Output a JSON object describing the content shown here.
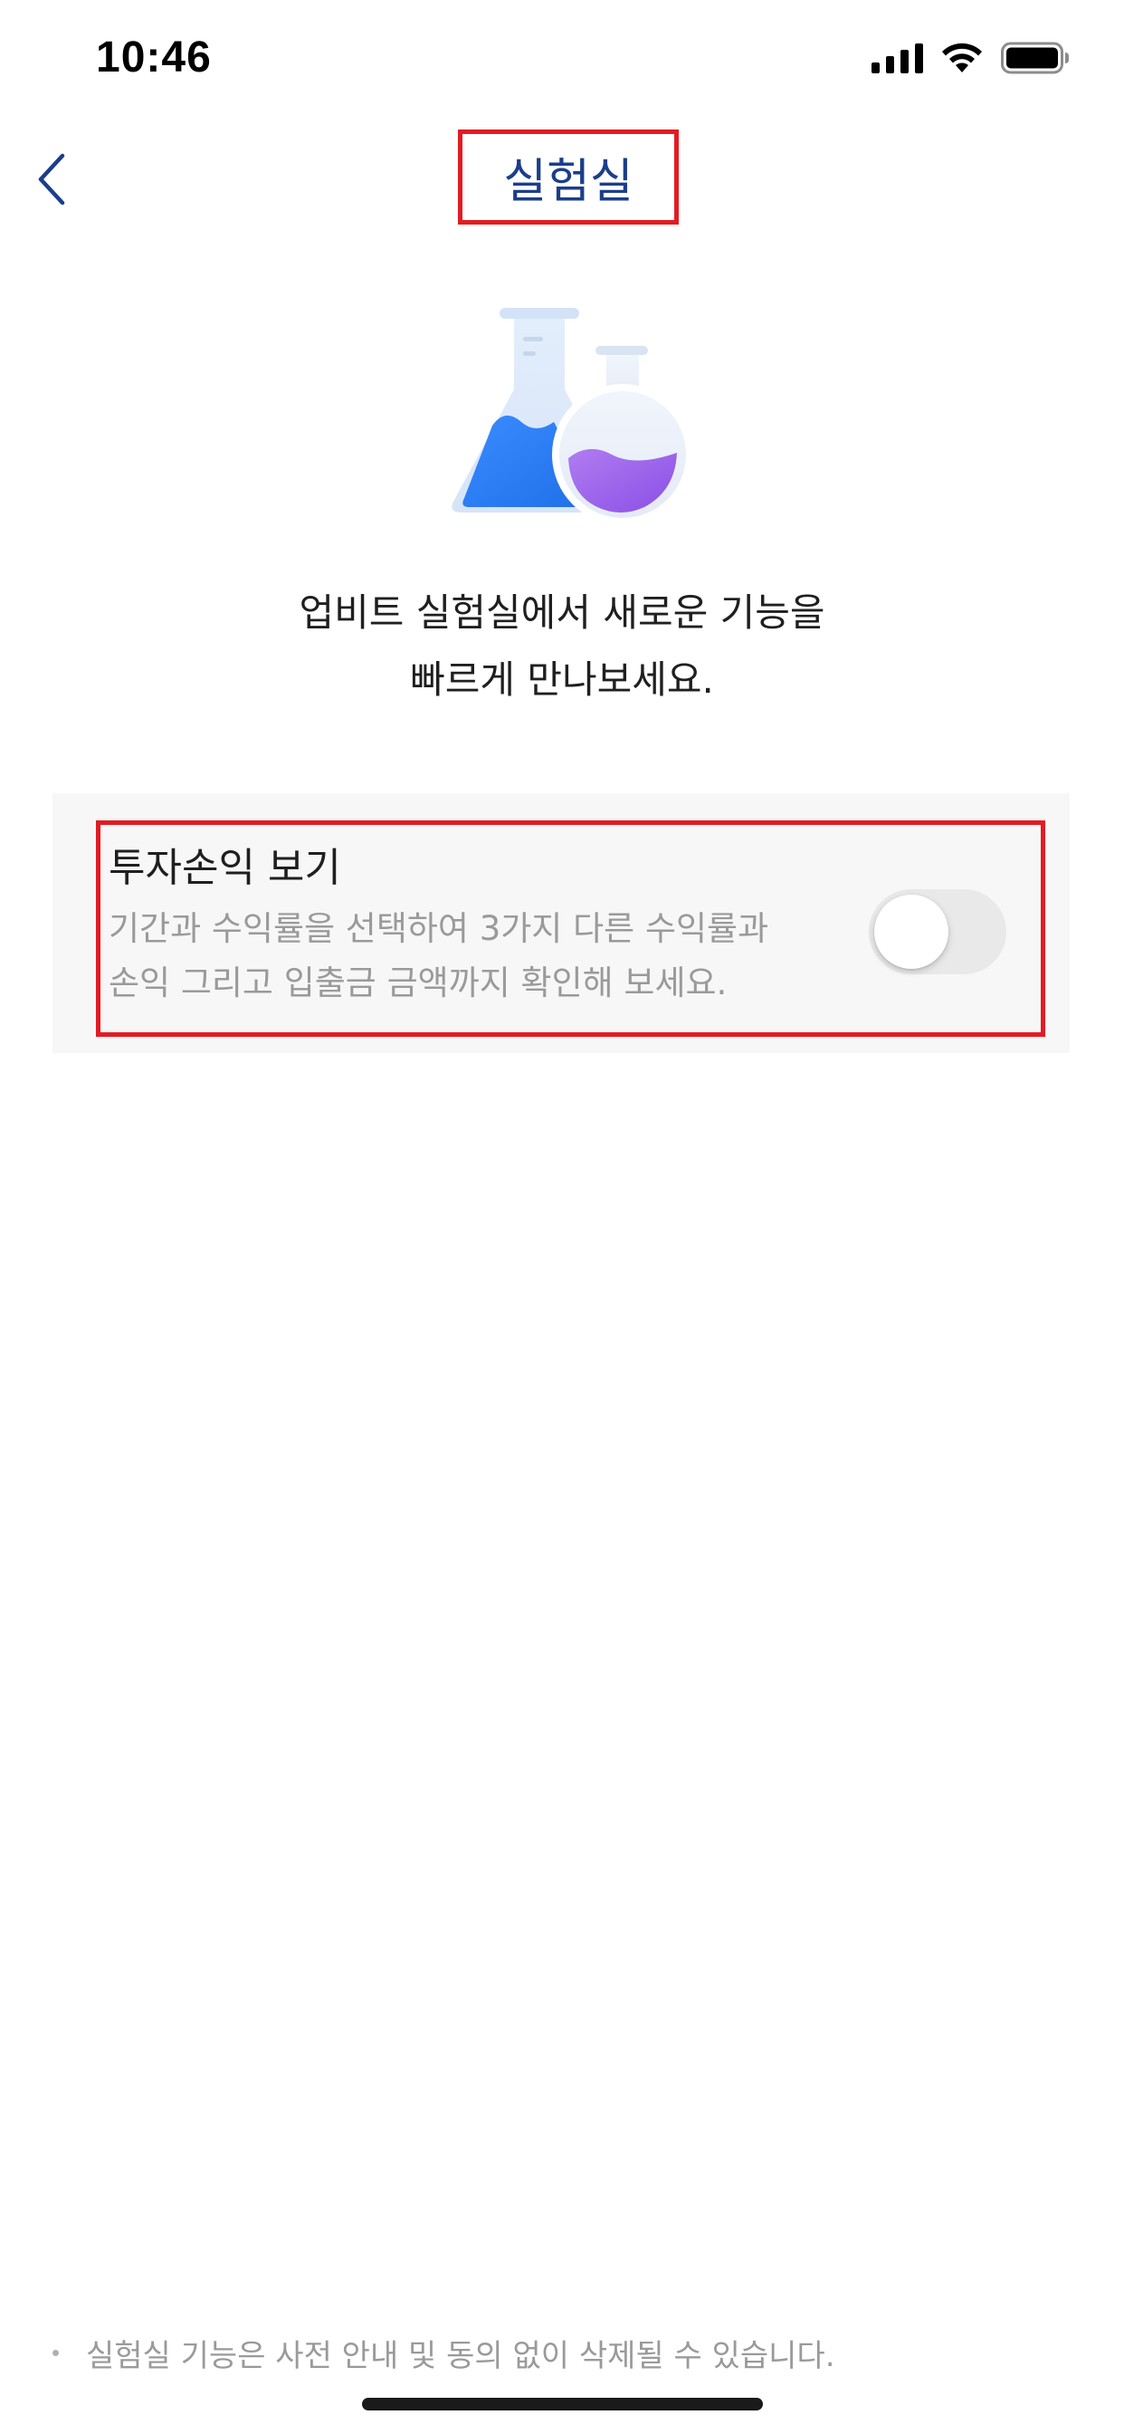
{
  "status_bar": {
    "time": "10:46",
    "icons": [
      "cellular-signal-icon",
      "wifi-icon",
      "battery-icon"
    ]
  },
  "nav": {
    "title": "실험실",
    "back_icon": "chevron-left-icon"
  },
  "hero": {
    "illustration": "lab-flasks-icon",
    "line1": "업비트 실험실에서 새로운 기능을",
    "line2": "빠르게 만나보세요."
  },
  "features": [
    {
      "title": "투자손익 보기",
      "description_line1": "기간과 수익률을 선택하여 3가지 다른 수익률과",
      "description_line2": "손익 그리고 입출금 금액까지 확인해 보세요.",
      "enabled": false
    }
  ],
  "footer": {
    "note": "실험실 기능은 사전 안내 및 동의 없이 삭제될 수 있습니다."
  },
  "colors": {
    "title": "#1b3e8c",
    "highlight": "#e31b23",
    "toggle_off": "#e9e9ea",
    "card_bg": "#f7f7f7",
    "secondary_text": "#9a9a9a"
  }
}
